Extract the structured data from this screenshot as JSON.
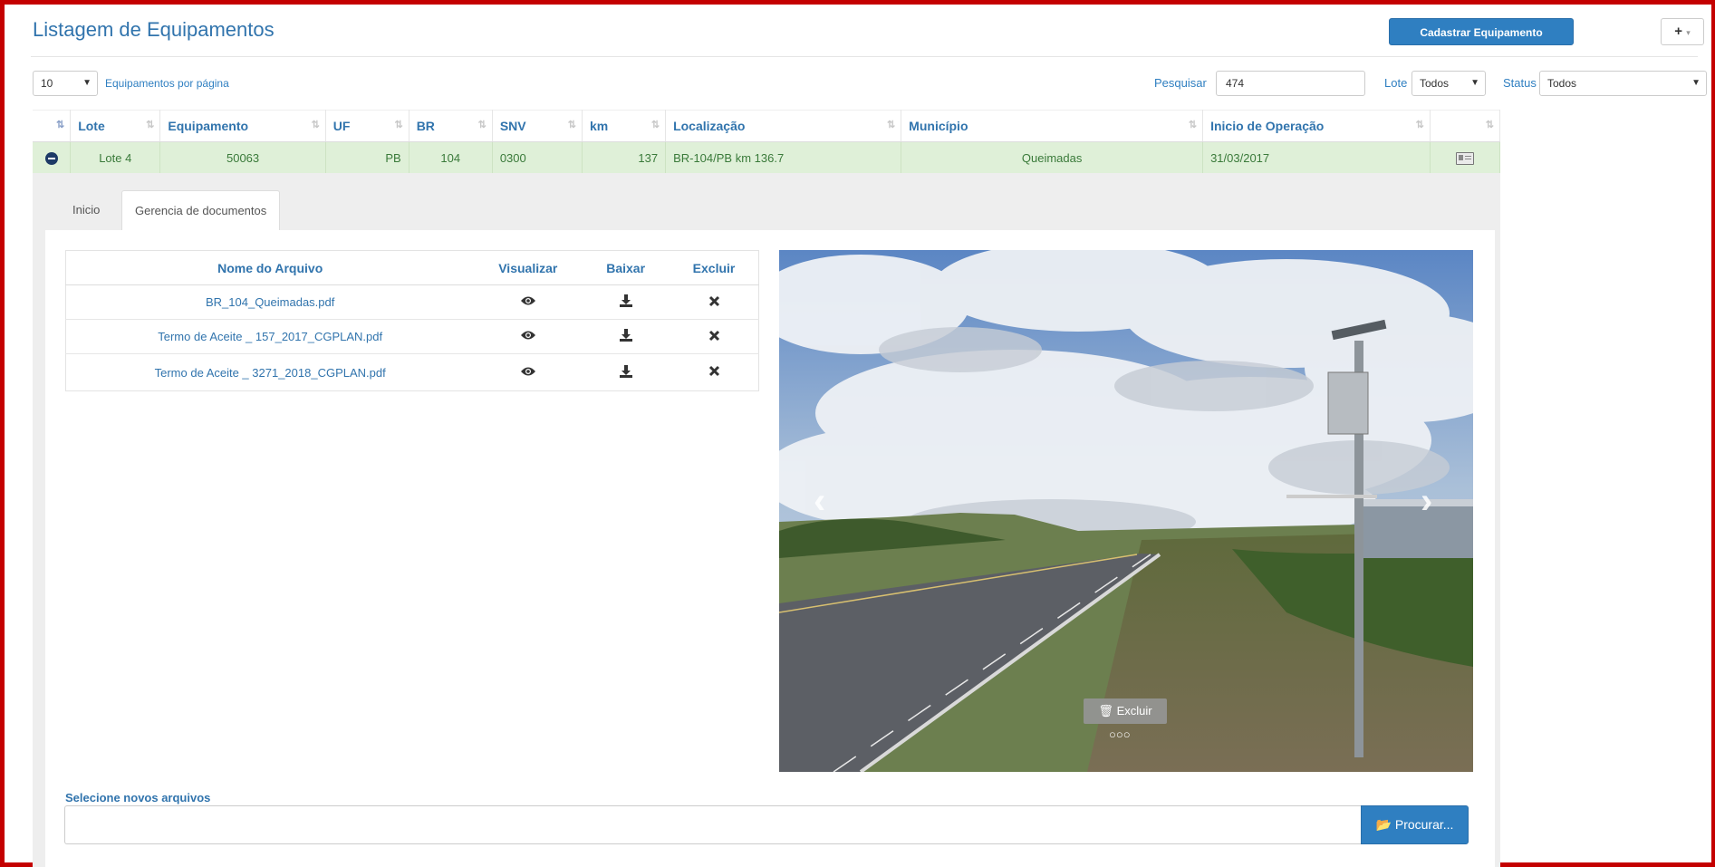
{
  "header": {
    "title": "Listagem de Equipamentos",
    "register_button": "Cadastrar Equipamento",
    "plus_button": "+",
    "plus_caret": "▾"
  },
  "controls": {
    "page_size": "10",
    "page_size_arrow": "▼",
    "page_size_label": "Equipamentos por página",
    "search_label": "Pesquisar",
    "search_value": "474",
    "lote_label": "Lote",
    "lote_value": "Todos",
    "status_label": "Status",
    "status_value": "Todos",
    "arrow": "▼"
  },
  "table": {
    "columns": [
      "Lote",
      "Equipamento",
      "UF",
      "BR",
      "SNV",
      "km",
      "Localização",
      "Município",
      "Inicio de Operação"
    ],
    "row": {
      "lote": "Lote 4",
      "equipamento": "50063",
      "uf": "PB",
      "br": "104",
      "snv": "0300",
      "km": "137",
      "localizacao": "BR-104/PB km 136.7",
      "municipio": "Queimadas",
      "inicio": "31/03/2017"
    }
  },
  "tabs": {
    "inicio": "Inicio",
    "docs": "Gerencia de documentos"
  },
  "documents": {
    "headers": {
      "name": "Nome do Arquivo",
      "view": "Visualizar",
      "download": "Baixar",
      "delete": "Excluir"
    },
    "files": [
      "BR_104_Queimadas.pdf",
      "Termo de Aceite _ 157_2017_CGPLAN.pdf",
      "Termo de Aceite _ 3271_2018_CGPLAN.pdf"
    ]
  },
  "carousel": {
    "delete_label": "Excluir",
    "dots": "○○○",
    "prev": "‹",
    "next": "›"
  },
  "upload": {
    "label": "Selecione novos arquivos",
    "button": "Procurar..."
  },
  "colors": {
    "accent": "#2f7fc1",
    "row_highlight": "#dff0d8",
    "frame": "#c40000"
  }
}
